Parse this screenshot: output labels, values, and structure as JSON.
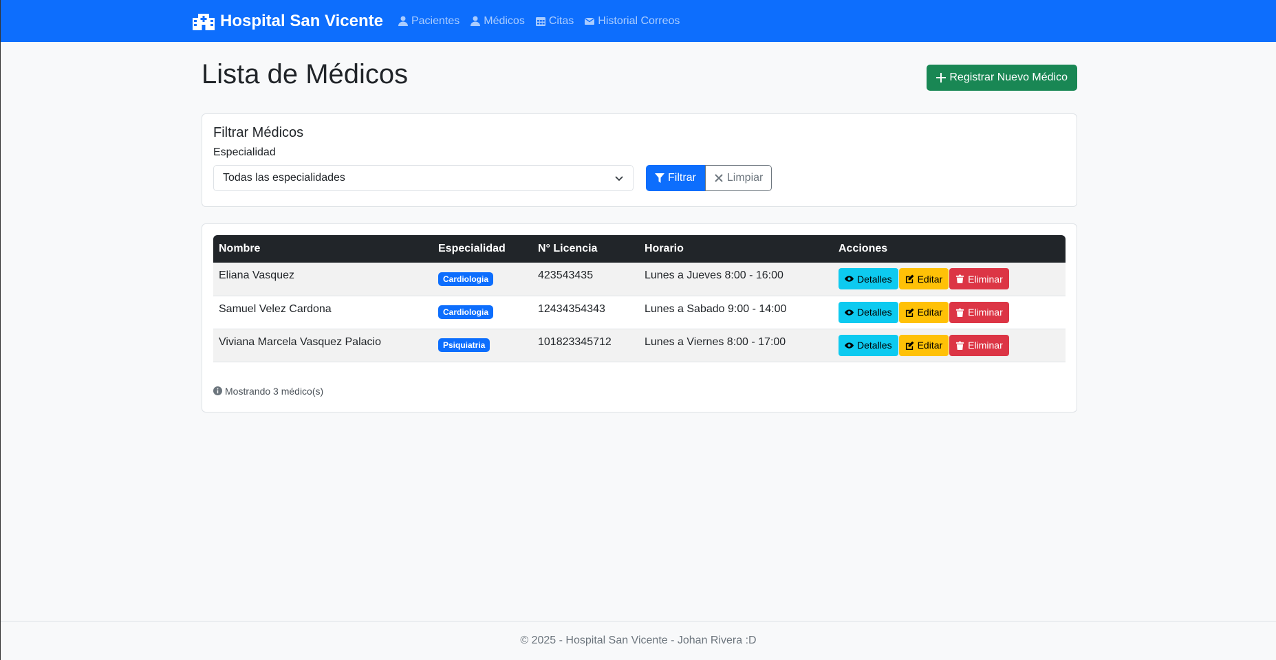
{
  "nav": {
    "brand": "Hospital San Vicente",
    "links": [
      "Pacientes",
      "Médicos",
      "Citas",
      "Historial Correos"
    ]
  },
  "header": {
    "title": "Lista de Médicos",
    "new_button": "Registrar Nuevo Médico"
  },
  "filter": {
    "title": "Filtrar Médicos",
    "label": "Especialidad",
    "selected": "Todas las especialidades",
    "filter_button": "Filtrar",
    "clear_button": "Limpiar"
  },
  "table": {
    "headers": [
      "Nombre",
      "Especialidad",
      "N° Licencia",
      "Horario",
      "Acciones"
    ],
    "rows": [
      {
        "nombre": "Eliana Vasquez",
        "especialidad": "Cardiologia",
        "licencia": "423543435",
        "horario": "Lunes a Jueves 8:00 - 16:00"
      },
      {
        "nombre": "Samuel Velez Cardona",
        "especialidad": "Cardiologia",
        "licencia": "12434354343",
        "horario": "Lunes a Sabado 9:00 - 14:00"
      },
      {
        "nombre": "Viviana Marcela Vasquez Palacio",
        "especialidad": "Psiquiatria",
        "licencia": "101823345712",
        "horario": "Lunes a Viernes 8:00 - 17:00"
      }
    ],
    "actions": {
      "details": "Detalles",
      "edit": "Editar",
      "delete": "Eliminar"
    },
    "count_text": "Mostrando 3 médico(s)"
  },
  "footer": {
    "text": "© 2025 - Hospital San Vicente - Johan Rivera :D"
  },
  "colors": {
    "primary": "#0d6efd",
    "success": "#198754",
    "info": "#0dcaf0",
    "warning": "#ffc107",
    "danger": "#dc3545",
    "dark": "#212529"
  }
}
